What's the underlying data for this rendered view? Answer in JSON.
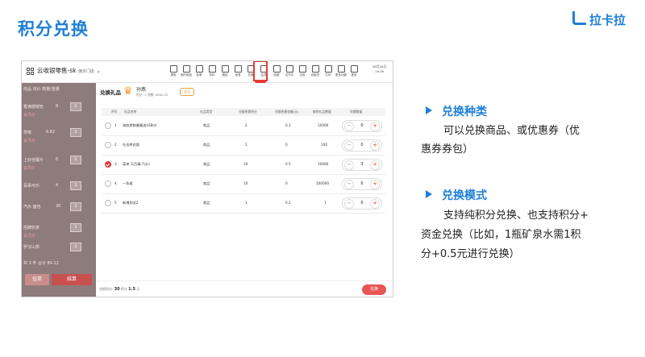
{
  "page": {
    "title": "积分兑换",
    "brand": "拉卡拉"
  },
  "app": {
    "store_name": "云收银零售-sk",
    "store_sub": "演示门店",
    "datetime_line1": "08月28日",
    "datetime_line2": "16:36",
    "toolbar": [
      {
        "label": "提前",
        "icon": "lightning-icon"
      },
      {
        "label": "临时商品",
        "icon": "box-icon"
      },
      {
        "label": "挂单",
        "icon": "bag-icon"
      },
      {
        "label": "折扣",
        "icon": "tag-icon"
      },
      {
        "label": "赠品",
        "icon": "gift-icon"
      },
      {
        "label": "优惠",
        "icon": "coupon-icon"
      },
      {
        "label": "兑换",
        "icon": "exchange-icon"
      },
      {
        "label": "会员",
        "icon": "member-icon"
      },
      {
        "label": "收银",
        "icon": "cash-icon"
      },
      {
        "label": "支付中",
        "icon": "pay-icon"
      },
      {
        "label": "交班",
        "icon": "shift-icon"
      },
      {
        "label": "存取货",
        "icon": "storage-icon"
      },
      {
        "label": "打印",
        "icon": "printer-icon"
      },
      {
        "label": "更多功能",
        "icon": "more-icon"
      },
      {
        "label": "更多",
        "icon": "menu-icon"
      }
    ],
    "left_pane": {
      "header": "商品   单价   数量/重量",
      "rows": [
        {
          "name": "香满楼鲜奶",
          "price": "8",
          "qty": "1",
          "sub": "会员价"
        },
        {
          "name": "草莓",
          "price": "6.82",
          "qty": "1",
          "sub": "会员价"
        },
        {
          "name": "上好佳薯片",
          "price": "6",
          "qty": "1",
          "sub": "会员价"
        },
        {
          "name": "百事可乐",
          "price": "4",
          "qty": "1",
          "sub": ""
        },
        {
          "name": "汽水·面包",
          "price": "30",
          "qty": "1",
          "sub": ""
        },
        {
          "name": "招牌奶茶",
          "price": "",
          "qty": "1",
          "sub": "会员价"
        },
        {
          "name": "罗汉山茶",
          "price": "",
          "qty": "1",
          "sub": ""
        }
      ],
      "summary": "共 3 件  合计  84.12",
      "btn_left": "挂单",
      "btn_right": "结算"
    },
    "modal": {
      "title": "兑换礼品",
      "user": "孙燕",
      "user_info": "积分: 1   余额: ¥642.25",
      "tag": "会员",
      "columns": [
        "序号",
        "礼品名称",
        "礼品类型",
        "兑换所需积分",
        "兑换所需金额(元)",
        "剩余礼品数量",
        "兑换数量"
      ],
      "rows": [
        {
          "no": "1",
          "name": "海底捞鲜酱酱油168ml",
          "type": "商品",
          "points": "2",
          "money": "0.1",
          "stock": "10000",
          "qty": "0",
          "selected": false
        },
        {
          "no": "2",
          "name": "在金库花角",
          "type": "商品",
          "points": "1",
          "money": "0",
          "stock": "100",
          "qty": "0",
          "selected": false
        },
        {
          "no": "3",
          "name": "菜单 1(百毒·汽水)",
          "type": "商品",
          "points": "10",
          "money": "0.5",
          "stock": "10000",
          "qty": "3",
          "selected": true
        },
        {
          "no": "4",
          "name": "一条裙",
          "type": "商品",
          "points": "10",
          "money": "0",
          "stock": "100000",
          "qty": "0",
          "selected": false
        },
        {
          "no": "5",
          "name": "新增测试2",
          "type": "商品",
          "points": "1",
          "money": "0.2",
          "stock": "1",
          "qty": "0",
          "selected": false
        }
      ],
      "footer_label": "兑换积分:",
      "footer_points": "30",
      "footer_mid": "积分",
      "footer_money": "1.5",
      "footer_unit": "元",
      "exchange_btn": "兑换"
    }
  },
  "sections": [
    {
      "title": "兑换种类",
      "lines": [
        "可以兑换商品、或优惠券（优",
        "惠券券包）"
      ]
    },
    {
      "title": "兑换模式",
      "lines": [
        "支持纯积分兑换、也支持积分+",
        "资金兑换（比如，1瓶矿泉水需1积",
        "分+0.5元进行兑换）"
      ]
    }
  ],
  "colors": {
    "accent": "#1e7fd8",
    "highlight": "#e53935"
  }
}
